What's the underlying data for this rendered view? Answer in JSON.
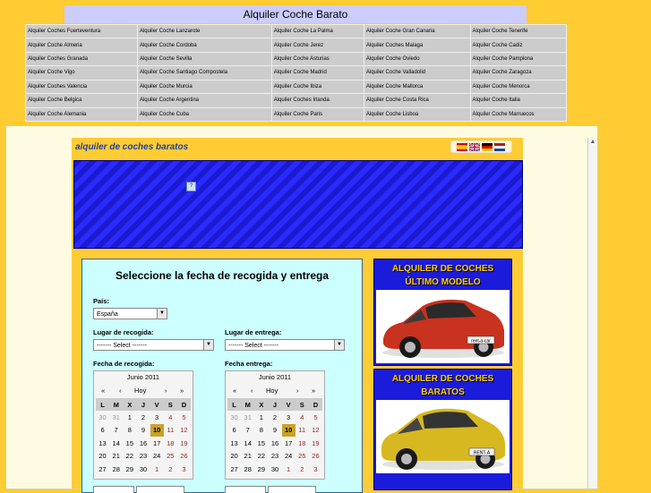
{
  "header": {
    "title": "Alquiler Coche Barato"
  },
  "links": [
    [
      "Alquiler Coches Fuerteventura",
      "Alquiler Coche Lanzarote",
      "Alquiler Coche La Palma",
      "Alquiler Coche Gran Canaria",
      "Alquiler Coche Tenerife"
    ],
    [
      "Alquiler Coche Almeria",
      "Alquiler Coche Cordoba",
      "Alquiler Coche Jerez",
      "Alquiler Coches Malaga",
      "Alquiler Coche Cadiz"
    ],
    [
      "Alquiler Coches Granada",
      "Alquiler Coche Sevilla",
      "Alquiler Coche Asturias",
      "Alquiler Coche Oviedo",
      "Alquiler Coche Pamplona"
    ],
    [
      "Alquiler Coche Vigo",
      "Alquiler Coche Santiago Compostela",
      "Alquiler Coche Madrid",
      "Alquiler Coche Valladolid",
      "Alquiler Coche Zaragoza"
    ],
    [
      "Alquiler Coches Valencia",
      "Alquiler Coche Murcia",
      "Alquiler Coche Ibiza",
      "Alquiler Coche Mallorca",
      "Alquiler Coche Menorca"
    ],
    [
      "Alquiler Coche Belgica",
      "Alquiler Coche Argentina",
      "Alquiler Coches Irlanda",
      "Alquiler Coche Costa Rica",
      "Alquiler Coche Italia"
    ],
    [
      "Alquiler Coche Alemania",
      "Alquiler Coche Cuba",
      "Alquiler Coche Paris",
      "Alquiler Coche Lisboa",
      "Alquiler Coche Marruecos"
    ]
  ],
  "site": {
    "slogan": "alquiler de coches baratos"
  },
  "flags": [
    "spanish-flag-icon",
    "uk-flag-icon",
    "german-flag-icon",
    "dutch-flag-icon"
  ],
  "form": {
    "title": "Seleccione la fecha de recogida y entrega",
    "country_label": "País:",
    "country_value": "España",
    "pickup_place_label": "Lugar de recogida:",
    "pickup_place_value": "------- Select -------",
    "return_place_label": "Lugar de entrega:",
    "return_place_value": "------- Select -------",
    "pickup_date_label": "Fecha de recogida:",
    "return_date_label": "Fecha entrega:"
  },
  "calendar": {
    "month": "Junio 2011",
    "today": "Hoy",
    "prev_year": "«",
    "prev_month": "‹",
    "next_month": "›",
    "next_year": "»",
    "weekdays": [
      "L",
      "M",
      "X",
      "J",
      "V",
      "S",
      "D"
    ],
    "weeks": [
      [
        "30",
        "31",
        "1",
        "2",
        "3",
        "4",
        "5"
      ],
      [
        "6",
        "7",
        "8",
        "9",
        "10",
        "11",
        "12"
      ],
      [
        "13",
        "14",
        "15",
        "16",
        "17",
        "18",
        "19"
      ],
      [
        "20",
        "21",
        "22",
        "23",
        "24",
        "25",
        "26"
      ],
      [
        "27",
        "28",
        "29",
        "30",
        "1",
        "2",
        "3"
      ]
    ],
    "selected_day": "10"
  },
  "promos": [
    {
      "text_line1": "ALQUILER DE COCHES",
      "text_line2": "ÚLTIMO MODELO",
      "image": "red-car-image",
      "plate": "rent-a-car"
    },
    {
      "text_line1": "ALQUILER DE COCHES",
      "text_line2": "BARATOS",
      "image": "yellow-car-image",
      "plate": "RENT-A"
    }
  ],
  "colors": {
    "page_bg": "#ffcc33",
    "header_bg": "#ccccff",
    "link_cell_bg": "#cccccc",
    "banner_blue": "#2a2aff",
    "form_bg": "#ccffff",
    "promo_text": "#ffcc00",
    "today_highlight": "#c9a227"
  }
}
